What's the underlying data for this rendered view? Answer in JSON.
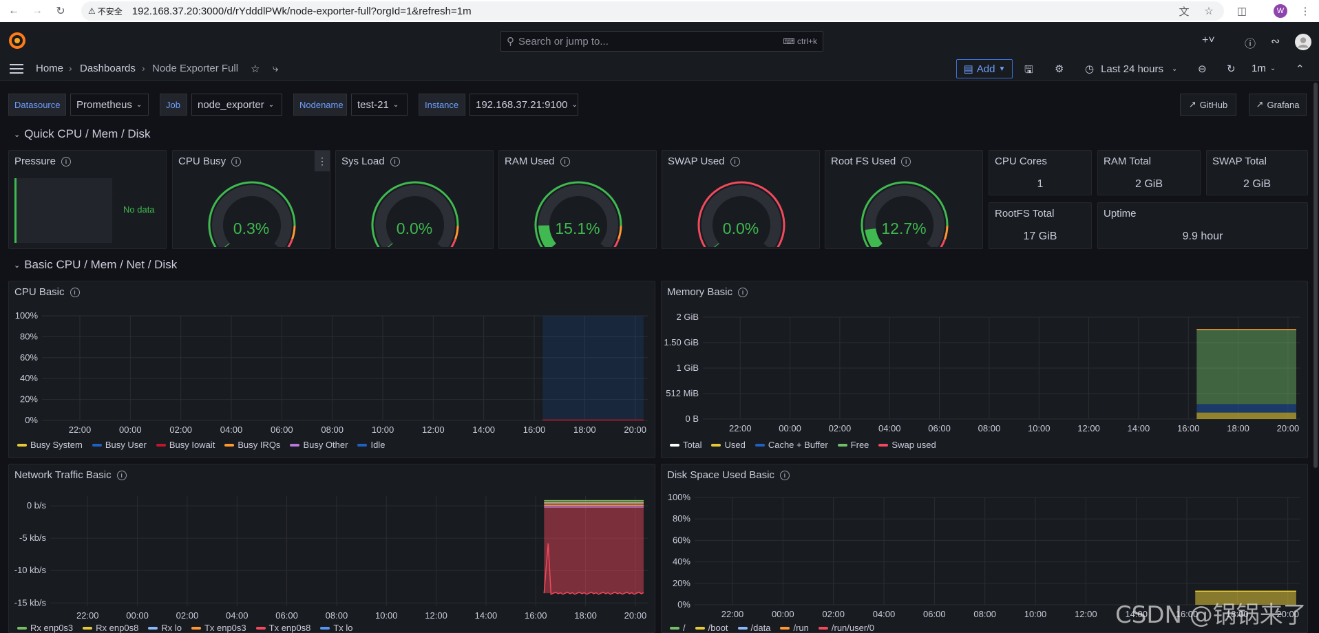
{
  "browser": {
    "security_label": "不安全",
    "url": "192.168.37.20:3000/d/rYdddlPWk/node-exporter-full?orgId=1&refresh=1m",
    "profile_initial": "W"
  },
  "topbar": {
    "search_placeholder": "Search or jump to...",
    "search_shortcut": "ctrl+k"
  },
  "breadcrumb": {
    "home": "Home",
    "dashboards": "Dashboards",
    "current": "Node Exporter Full"
  },
  "toolbar": {
    "add_label": "Add",
    "time_range": "Last 24 hours",
    "refresh_interval": "1m"
  },
  "variables": [
    {
      "label": "Datasource",
      "value": "Prometheus"
    },
    {
      "label": "Job",
      "value": "node_exporter"
    },
    {
      "label": "Nodename",
      "value": "test-21"
    },
    {
      "label": "Instance",
      "value": "192.168.37.21:9100"
    }
  ],
  "links": {
    "github": "GitHub",
    "grafana": "Grafana"
  },
  "rows": {
    "quick": "Quick CPU / Mem / Disk",
    "basic": "Basic CPU / Mem / Net / Disk"
  },
  "quick_panels": {
    "pressure": {
      "title": "Pressure",
      "no_data": "No data"
    },
    "gauges": [
      {
        "title": "CPU Busy",
        "value": "0.3%",
        "percent": 0.3
      },
      {
        "title": "Sys Load",
        "value": "0.0%",
        "percent": 0.0
      },
      {
        "title": "RAM Used",
        "value": "15.1%",
        "percent": 15.1
      },
      {
        "title": "SWAP Used",
        "value": "0.0%",
        "percent": 0.0
      },
      {
        "title": "Root FS Used",
        "value": "12.7%",
        "percent": 12.7
      }
    ],
    "stats": [
      {
        "title": "CPU Cores",
        "value": "1"
      },
      {
        "title": "RAM Total",
        "value": "2 GiB"
      },
      {
        "title": "SWAP Total",
        "value": "2 GiB"
      },
      {
        "title": "RootFS Total",
        "value": "17 GiB"
      },
      {
        "title": "Uptime",
        "value": "9.9 hour"
      }
    ]
  },
  "colors": {
    "green": "#3fb950",
    "yellow": "#e5c936",
    "red": "#f2495c",
    "orange": "#ff9830",
    "blue": "#5794f2",
    "dark_blue": "#1f60c4",
    "purple": "#b877d9",
    "accent": "#6e9fff"
  },
  "chart_data": [
    {
      "type": "area",
      "title": "CPU Basic",
      "x_ticks": [
        "22:00",
        "00:00",
        "02:00",
        "04:00",
        "06:00",
        "08:00",
        "10:00",
        "12:00",
        "14:00",
        "16:00",
        "18:00",
        "20:00"
      ],
      "y_ticks": [
        "100%",
        "80%",
        "60%",
        "40%",
        "20%",
        "0%"
      ],
      "ylim": [
        0,
        100
      ],
      "series": [
        {
          "name": "Busy System",
          "color": "#e5c936"
        },
        {
          "name": "Busy User",
          "color": "#1f60c4"
        },
        {
          "name": "Busy Iowait",
          "color": "#c4162a"
        },
        {
          "name": "Busy IRQs",
          "color": "#ff9830"
        },
        {
          "name": "Busy Other",
          "color": "#b877d9"
        },
        {
          "name": "Idle",
          "color": "#1f60c4"
        }
      ],
      "data_start": "16:20",
      "data_end": "20:20",
      "idle_percent": 99.7
    },
    {
      "type": "area",
      "title": "Memory Basic",
      "x_ticks": [
        "22:00",
        "00:00",
        "02:00",
        "04:00",
        "06:00",
        "08:00",
        "10:00",
        "12:00",
        "14:00",
        "16:00",
        "18:00",
        "20:00"
      ],
      "y_ticks": [
        "2 GiB",
        "1.50 GiB",
        "1 GiB",
        "512 MiB",
        "0 B"
      ],
      "ylim": [
        0,
        2048
      ],
      "series": [
        {
          "name": "Total",
          "color": "#ffffff"
        },
        {
          "name": "Used",
          "color": "#e5c936"
        },
        {
          "name": "Cache + Buffer",
          "color": "#1f60c4"
        },
        {
          "name": "Free",
          "color": "#73bf69"
        },
        {
          "name": "Swap used",
          "color": "#f2495c"
        }
      ],
      "data_start": "16:20",
      "data_end": "20:20",
      "values_mib": {
        "total": 1800,
        "used": 130,
        "cache_buffer": 170,
        "free": 1500
      }
    },
    {
      "type": "area",
      "title": "Network Traffic Basic",
      "x_ticks": [
        "22:00",
        "00:00",
        "02:00",
        "04:00",
        "06:00",
        "08:00",
        "10:00",
        "12:00",
        "14:00",
        "16:00",
        "18:00",
        "20:00"
      ],
      "y_ticks": [
        "0 b/s",
        "-5 kb/s",
        "-10 kb/s",
        "-15 kb/s"
      ],
      "ylim": [
        -15.5,
        1.5
      ],
      "series": [
        {
          "name": "Rx enp0s3",
          "color": "#73bf69"
        },
        {
          "name": "Rx enp0s8",
          "color": "#e5c936"
        },
        {
          "name": "Rx lo",
          "color": "#8ab8ff"
        },
        {
          "name": "Tx enp0s3",
          "color": "#ff9830"
        },
        {
          "name": "Tx enp0s8",
          "color": "#f2495c"
        },
        {
          "name": "Tx lo",
          "color": "#5794f2"
        }
      ],
      "data_start": "16:20",
      "data_end": "20:20",
      "tx_enp0s8_kbps": -13.5,
      "tx_spike_kbps": -5.8
    },
    {
      "type": "area",
      "title": "Disk Space Used Basic",
      "x_ticks": [
        "22:00",
        "00:00",
        "02:00",
        "04:00",
        "06:00",
        "08:00",
        "10:00",
        "12:00",
        "14:00",
        "16:00",
        "18:00",
        "20:00"
      ],
      "y_ticks": [
        "100%",
        "80%",
        "60%",
        "40%",
        "20%",
        "0%"
      ],
      "ylim": [
        0,
        100
      ],
      "series": [
        {
          "name": "/",
          "color": "#73bf69"
        },
        {
          "name": "/boot",
          "color": "#e5c936"
        },
        {
          "name": "/data",
          "color": "#8ab8ff"
        },
        {
          "name": "/run",
          "color": "#ff9830"
        },
        {
          "name": "/run/user/0",
          "color": "#f2495c"
        }
      ],
      "data_start": "16:20",
      "data_end": "20:20",
      "root_percent": 12.7
    }
  ],
  "watermark": "CSDN @锅锅来了"
}
